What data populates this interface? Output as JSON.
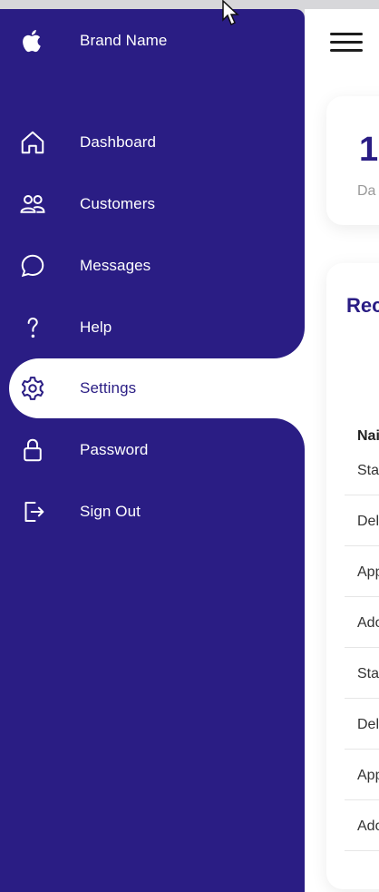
{
  "sidebar": {
    "brand": {
      "icon": "apple-icon",
      "label": "Brand Name"
    },
    "items": [
      {
        "icon": "home-icon",
        "label": "Dashboard"
      },
      {
        "icon": "people-icon",
        "label": "Customers"
      },
      {
        "icon": "chat-icon",
        "label": "Messages"
      },
      {
        "icon": "help-icon",
        "label": "Help"
      },
      {
        "icon": "gear-icon",
        "label": "Settings",
        "active": true
      },
      {
        "icon": "lock-icon",
        "label": "Password"
      },
      {
        "icon": "sign-out-icon",
        "label": "Sign Out"
      }
    ]
  },
  "main": {
    "card": {
      "number": "1",
      "label": "Da"
    },
    "orders": {
      "title": "Rec",
      "header": "Nai",
      "rows": [
        "Sta",
        "Del",
        "App",
        "Ado",
        "Sta",
        "Del",
        "App",
        "Ado"
      ]
    }
  },
  "colors": {
    "sidebar": "#2a1d84",
    "accent": "#2a1d84",
    "background": "#ffffff"
  }
}
